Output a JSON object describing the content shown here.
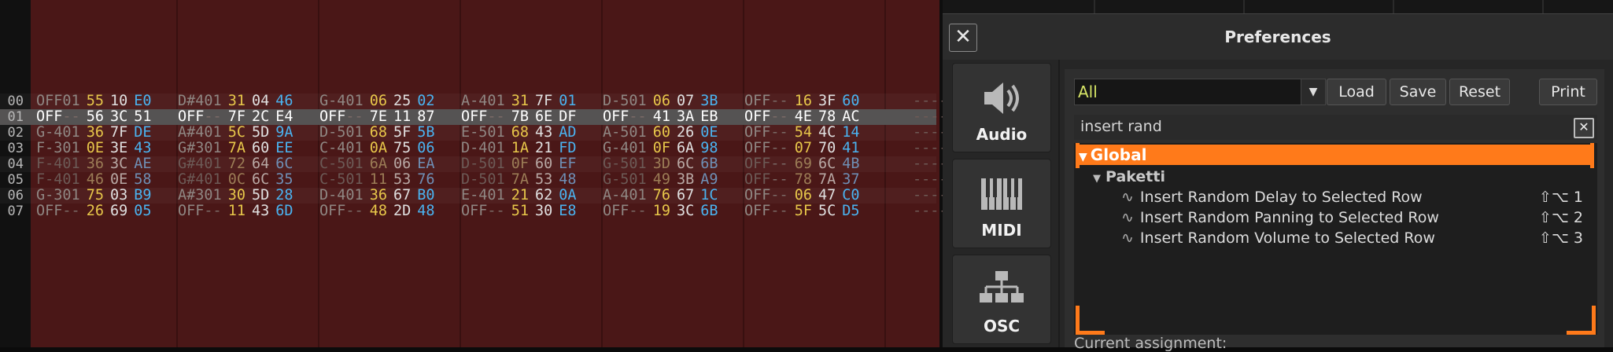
{
  "line_numbers": [
    "00",
    "01",
    "02",
    "03",
    "04",
    "05",
    "06",
    "07"
  ],
  "pattern_rows": [
    {
      "id": "r0",
      "cells": [
        [
          "OFF",
          "01",
          "55",
          "10",
          "E0"
        ],
        [
          "D#4",
          "01",
          "31",
          "04",
          "46"
        ],
        [
          "G-4",
          "01",
          "06",
          "25",
          "02"
        ],
        [
          "A-4",
          "01",
          "31",
          "7F",
          "01"
        ],
        [
          "D-5",
          "01",
          "06",
          "07",
          "3B"
        ],
        [
          "OFF",
          "--",
          "16",
          "3F",
          "60"
        ]
      ],
      "trail": "----"
    },
    {
      "id": "r1",
      "cells": [
        [
          "OFF",
          "--",
          "56",
          "3C",
          "51"
        ],
        [
          "OFF",
          "--",
          "7F",
          "2C",
          "E4"
        ],
        [
          "OFF",
          "--",
          "7E",
          "11",
          "87"
        ],
        [
          "OFF",
          "--",
          "7B",
          "6E",
          "DF"
        ],
        [
          "OFF",
          "--",
          "41",
          "3A",
          "EB"
        ],
        [
          "OFF",
          "--",
          "4E",
          "78",
          "AC"
        ]
      ],
      "trail": "----"
    },
    {
      "id": "r2",
      "cells": [
        [
          "G-4",
          "01",
          "36",
          "7F",
          "DE"
        ],
        [
          "A#4",
          "01",
          "5C",
          "5D",
          "9A"
        ],
        [
          "D-5",
          "01",
          "68",
          "5F",
          "5B"
        ],
        [
          "E-5",
          "01",
          "68",
          "43",
          "AD"
        ],
        [
          "A-5",
          "01",
          "60",
          "26",
          "0E"
        ],
        [
          "OFF",
          "--",
          "54",
          "4C",
          "14"
        ]
      ],
      "trail": "----"
    },
    {
      "id": "r3",
      "cells": [
        [
          "F-3",
          "01",
          "0E",
          "3E",
          "43"
        ],
        [
          "G#3",
          "01",
          "7A",
          "60",
          "EE"
        ],
        [
          "C-4",
          "01",
          "0A",
          "75",
          "06"
        ],
        [
          "D-4",
          "01",
          "1A",
          "21",
          "FD"
        ],
        [
          "G-4",
          "01",
          "0F",
          "6A",
          "98"
        ],
        [
          "OFF",
          "--",
          "07",
          "70",
          "41"
        ]
      ],
      "trail": "----"
    },
    {
      "id": "r4",
      "cells": [
        [
          "F-4",
          "01",
          "36",
          "3C",
          "AE"
        ],
        [
          "G#4",
          "01",
          "72",
          "64",
          "6C"
        ],
        [
          "C-5",
          "01",
          "6A",
          "06",
          "EA"
        ],
        [
          "D-5",
          "01",
          "0F",
          "60",
          "EF"
        ],
        [
          "G-5",
          "01",
          "3D",
          "6C",
          "6B"
        ],
        [
          "OFF",
          "--",
          "69",
          "6C",
          "4B"
        ]
      ],
      "trail": "----"
    },
    {
      "id": "r5",
      "cells": [
        [
          "F-4",
          "01",
          "46",
          "0E",
          "58"
        ],
        [
          "G#4",
          "01",
          "0C",
          "6C",
          "35"
        ],
        [
          "C-5",
          "01",
          "11",
          "53",
          "76"
        ],
        [
          "D-5",
          "01",
          "7A",
          "53",
          "48"
        ],
        [
          "G-5",
          "01",
          "49",
          "3B",
          "A9"
        ],
        [
          "OFF",
          "--",
          "78",
          "7A",
          "37"
        ]
      ],
      "trail": "----"
    },
    {
      "id": "r6",
      "cells": [
        [
          "G-3",
          "01",
          "75",
          "03",
          "B9"
        ],
        [
          "A#3",
          "01",
          "30",
          "5D",
          "28"
        ],
        [
          "D-4",
          "01",
          "36",
          "67",
          "B0"
        ],
        [
          "E-4",
          "01",
          "21",
          "62",
          "0A"
        ],
        [
          "A-4",
          "01",
          "76",
          "67",
          "1C"
        ],
        [
          "OFF",
          "--",
          "06",
          "47",
          "C0"
        ]
      ],
      "trail": "----"
    },
    {
      "id": "r7",
      "cells": [
        [
          "OFF",
          "--",
          "26",
          "69",
          "05"
        ],
        [
          "OFF",
          "--",
          "11",
          "43",
          "6D"
        ],
        [
          "OFF",
          "--",
          "48",
          "2D",
          "48"
        ],
        [
          "OFF",
          "--",
          "51",
          "30",
          "E8"
        ],
        [
          "OFF",
          "--",
          "19",
          "3C",
          "6B"
        ],
        [
          "OFF",
          "--",
          "5F",
          "5C",
          "D5"
        ]
      ],
      "trail": "----"
    }
  ],
  "prefs": {
    "title": "Preferences",
    "close_glyph": "✕",
    "categories": [
      {
        "label": "Audio",
        "icon": "speaker-icon"
      },
      {
        "label": "MIDI",
        "icon": "piano-keys-icon"
      },
      {
        "label": "OSC",
        "icon": "network-icon"
      }
    ],
    "filter_value": "All",
    "dropdown_arrow": "▼",
    "buttons": {
      "load": "Load",
      "save": "Save",
      "reset": "Reset",
      "print": "Print"
    },
    "search_value": "insert rand",
    "clear_glyph": "✕",
    "tree": {
      "root": "Global",
      "root_toggle": "▼",
      "group": "Paketti",
      "group_toggle": "▼",
      "wave_glyph": "∿",
      "items": [
        {
          "label": "Insert Random Delay to Selected Row",
          "shortcut": "⇧⌥ 1"
        },
        {
          "label": "Insert Random Panning to Selected Row",
          "shortcut": "⇧⌥ 2"
        },
        {
          "label": "Insert Random Volume to Selected Row",
          "shortcut": "⇧⌥ 3"
        }
      ]
    },
    "assignment_label": "Current assignment:"
  },
  "colors": {
    "accent": "#ff7a1a",
    "track_bg": "#4a1717",
    "selected_row": "#555353"
  }
}
